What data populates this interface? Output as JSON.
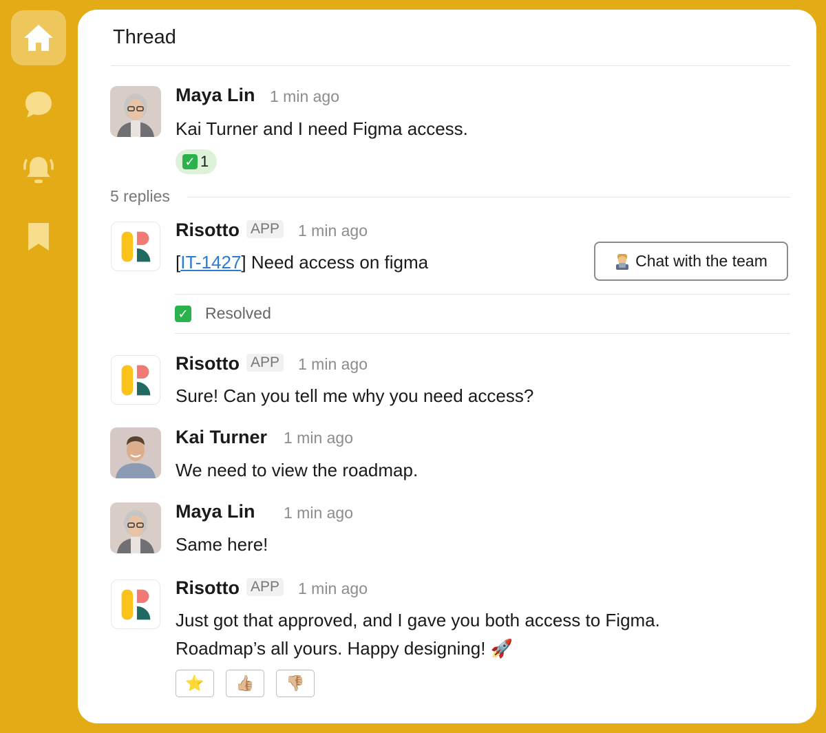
{
  "sidebar": {
    "items": [
      {
        "icon": "home-icon",
        "active": true
      },
      {
        "icon": "chat-bubble-icon",
        "active": false
      },
      {
        "icon": "bell-icon",
        "active": false
      },
      {
        "icon": "bookmark-icon",
        "active": false
      }
    ]
  },
  "thread": {
    "title": "Thread",
    "parent": {
      "author": "Maya Lin",
      "time": "1 min ago",
      "text": "Kai Turner and I need Figma access.",
      "reaction_count": "1"
    },
    "replies_label": "5 replies",
    "replies": [
      {
        "author": "Risotto",
        "tag": "APP",
        "time": "1 min ago",
        "ticket_open": "[",
        "ticket_id": "IT-1427",
        "ticket_close": "]",
        "ticket_text": " Need access on figma",
        "button_label": "Chat with the team",
        "status": "Resolved"
      },
      {
        "author": "Risotto",
        "tag": "APP",
        "time": "1 min ago",
        "text": "Sure! Can you tell me why you need access?"
      },
      {
        "author": "Kai Turner",
        "time": "1 min ago",
        "text": "We need to view the roadmap."
      },
      {
        "author": "Maya Lin",
        "time": "1 min ago",
        "text": "Same here!"
      },
      {
        "author": "Risotto",
        "tag": "APP",
        "time": "1 min ago",
        "text_line1": "Just got that approved, and I gave you both access to Figma.",
        "text_line2": "Roadmap’s all yours. Happy designing! 🚀"
      }
    ],
    "feedback": [
      "⭐",
      "👍🏼",
      "👎🏼"
    ]
  },
  "colors": {
    "background": "#E3AC16",
    "sidebar_icon": "#F8DD8C",
    "link": "#2b7bd4",
    "check_green": "#2BB24C",
    "reaction_bg": "#DDF2D9"
  }
}
